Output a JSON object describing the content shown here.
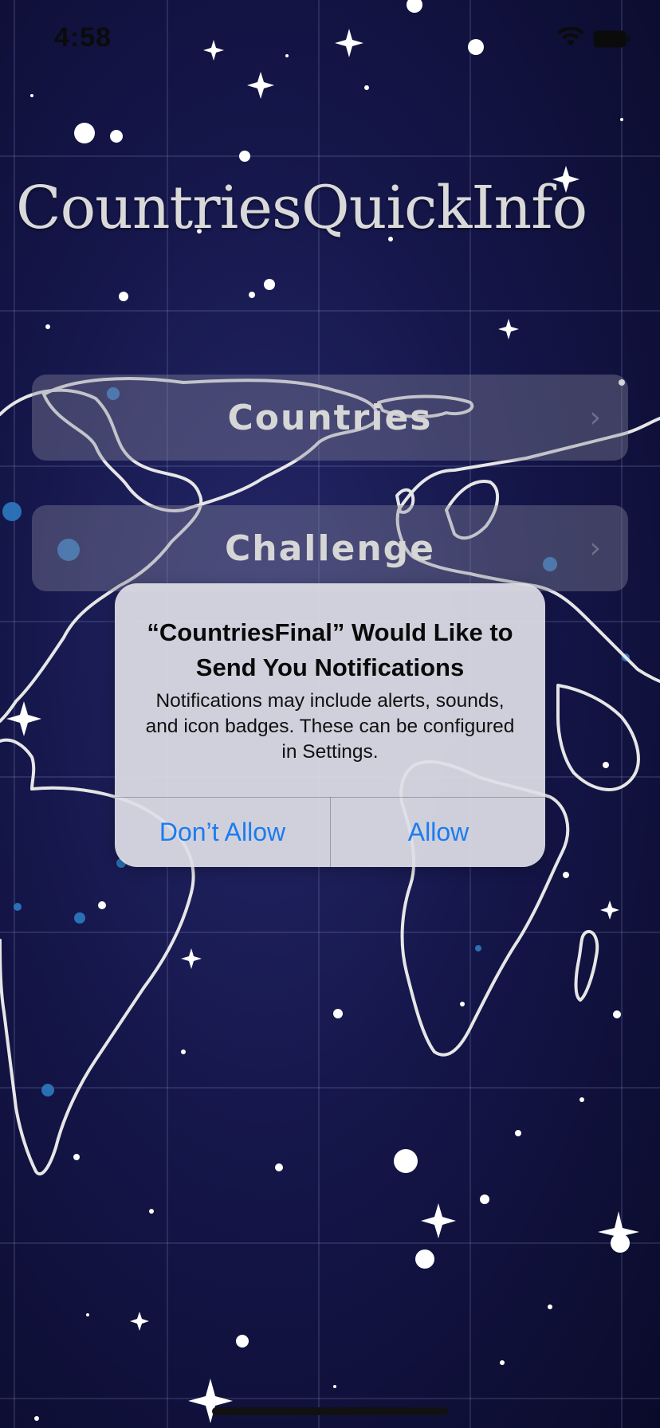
{
  "status_bar": {
    "time": "4:58"
  },
  "app": {
    "title": "CountriesQuickInfo"
  },
  "menu": {
    "countries_label": "Countries",
    "challenge_label": "Challenge",
    "chevron": "›"
  },
  "alert": {
    "title": "“CountriesFinal” Would Like to Send You Notifications",
    "message": "Notifications may include alerts, sounds, and icon badges. These can be configured in Settings.",
    "dont_allow_label": "Don’t Allow",
    "allow_label": "Allow"
  },
  "colors": {
    "accent_blue": "#1a7cf0",
    "background_space": "#15164a",
    "map_outline": "#e6e6e6"
  },
  "icons": {
    "wifi": "wifi-icon",
    "battery": "battery-icon",
    "chevron": "chevron-right-icon"
  }
}
